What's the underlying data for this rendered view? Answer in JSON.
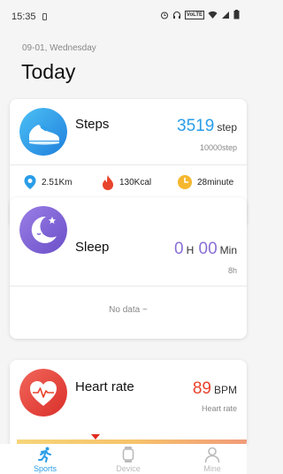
{
  "status_bar": {
    "time": "15:35",
    "volte_label": "VoLTE"
  },
  "header": {
    "date": "09-01, Wednesday",
    "title": "Today"
  },
  "steps_card": {
    "title": "Steps",
    "value": "3519",
    "unit": "step",
    "goal": "10000step",
    "stats": [
      {
        "icon": "location-pin-icon",
        "value": "2.51Km"
      },
      {
        "icon": "flame-icon",
        "value": "130Kcal"
      },
      {
        "icon": "clock-icon",
        "value": "28minute"
      }
    ],
    "accent_color": "#2a9de8"
  },
  "sleep_card": {
    "title": "Sleep",
    "hours": "0",
    "hours_unit": "H",
    "minutes": "00",
    "minutes_unit": "Min",
    "goal": "8h",
    "empty_text": "No data ~",
    "accent_color": "#8a6fd6"
  },
  "heart_card": {
    "title": "Heart rate",
    "value": "89",
    "unit": "BPM",
    "sub_label": "Heart rate",
    "accent_color": "#e8432c"
  },
  "bottom_nav": {
    "items": [
      {
        "label": "Sports",
        "icon": "running-icon",
        "active": true
      },
      {
        "label": "Device",
        "icon": "watch-icon",
        "active": false
      },
      {
        "label": "Mine",
        "icon": "person-icon",
        "active": false
      }
    ],
    "active_color": "#2a9de8",
    "inactive_color": "#bbbbbb"
  }
}
